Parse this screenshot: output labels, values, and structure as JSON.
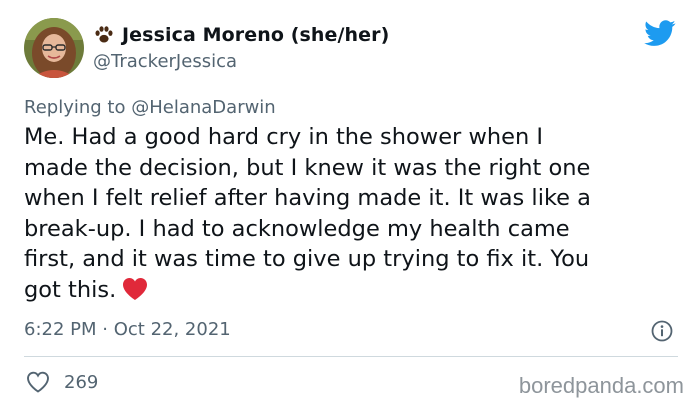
{
  "author": {
    "display_name": "Jessica Moreno (she/her)",
    "handle": "@TrackerJessica"
  },
  "reply": {
    "prefix": "Replying to",
    "mention": "@HelanaDarwin"
  },
  "tweet": {
    "lines": [
      "Me. Had a good hard cry in the shower when I",
      "made the decision, but I knew it was the right one",
      "when I felt relief after having made it. It was like a",
      "break-up. I had to acknowledge my health came",
      "first, and it was time to give up trying to fix it. You",
      "got this."
    ],
    "emoji": "red-heart"
  },
  "meta": {
    "time": "6:22 PM",
    "separator": "·",
    "date": "Oct 22, 2021"
  },
  "likes": {
    "count": "269"
  },
  "watermark": "boredpanda.com",
  "icons": {
    "brand": "twitter-bird-icon",
    "name_badge": "paw-print-icon",
    "info": "info-icon",
    "like": "heart-outline-icon"
  },
  "colors": {
    "twitter_blue": "#1d9bf0",
    "text": "#0f1419",
    "secondary": "#536471",
    "heart_red": "#e0293a",
    "paw": "#4a2b14"
  }
}
